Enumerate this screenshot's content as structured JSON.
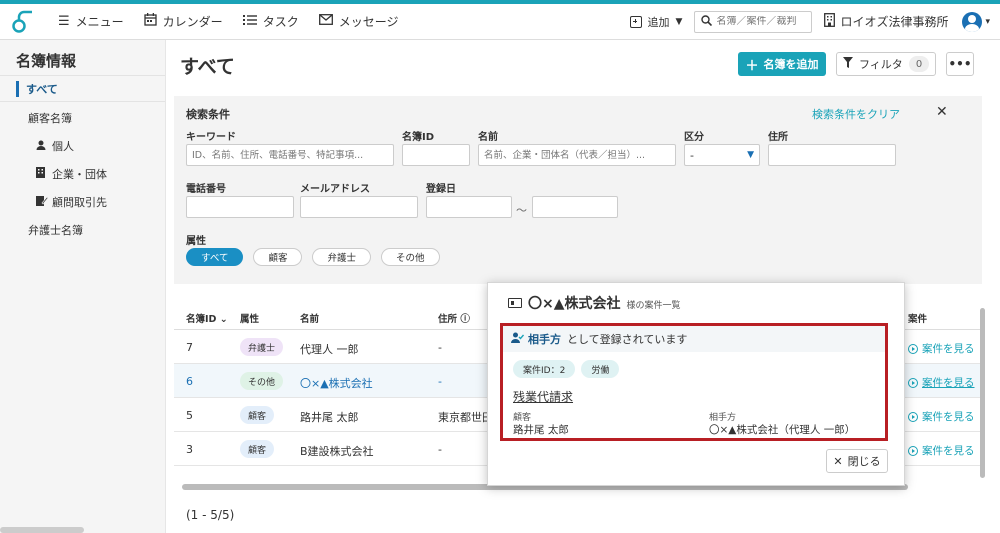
{
  "topbar": {
    "menu": "メニュー",
    "calendar": "カレンダー",
    "tasks": "タスク",
    "messages": "メッセージ",
    "add": "追加",
    "search_placeholder": "名簿／案件／裁判",
    "office": "ロイオズ法律事務所"
  },
  "sidebar": {
    "title": "名簿情報",
    "all": "すべて",
    "client_list": "顧客名簿",
    "individual": "個人",
    "company": "企業・団体",
    "advisory": "顧問取引先",
    "lawyer_list": "弁護士名簿"
  },
  "main": {
    "title": "すべて",
    "add_button": "名簿を追加",
    "filter_label": "フィルタ",
    "filter_count": "0",
    "more": "•••"
  },
  "search": {
    "title": "検索条件",
    "clear": "検索条件をクリア",
    "close": "✕",
    "keyword_label": "キーワード",
    "keyword_placeholder": "ID、名前、住所、電話番号、特記事項...",
    "id_label": "名簿ID",
    "name_label": "名前",
    "name_placeholder": "名前、企業・団体名（代表／担当）...",
    "category_label": "区分",
    "category_value": "-",
    "address_label": "住所",
    "phone_label": "電話番号",
    "email_label": "メールアドレス",
    "date_label": "登録日",
    "tilde": "～",
    "attr_label": "属性",
    "attrs": [
      "すべて",
      "顧客",
      "弁護士",
      "その他"
    ]
  },
  "table": {
    "headers": {
      "id": "名簿ID",
      "attr": "属性",
      "name": "名前",
      "address": "住所",
      "cases": "案件"
    },
    "rows": [
      {
        "id": "7",
        "attr": "弁護士",
        "name": "代理人 一郎",
        "address": "-",
        "link": "案件を見る"
      },
      {
        "id": "6",
        "attr": "その他",
        "name": "〇×▲株式会社",
        "address": "-",
        "link": "案件を見る"
      },
      {
        "id": "5",
        "attr": "顧客",
        "name": "路井尾 太郎",
        "address": "東京都世田",
        "link": "案件を見る"
      },
      {
        "id": "3",
        "attr": "顧客",
        "name": "B建設株式会社",
        "address": "-",
        "link": "案件を見る"
      }
    ],
    "pager": "(1 - 5/5)"
  },
  "popup": {
    "name": "〇×▲株式会社",
    "subtitle": "様の案件一覧",
    "role": "相手方",
    "role_suffix": "として登録されています",
    "case_id": "案件ID：2",
    "case_type": "労働",
    "case_name": "残業代請求",
    "client_label": "顧客",
    "client_value": "路井尾 太郎",
    "opponent_label": "相手方",
    "opponent_value": "〇×▲株式会社（代理人 一郎）",
    "close": "閉じる"
  },
  "colors": {
    "accent": "#1aa3b8",
    "highlight_border": "#b81f24"
  }
}
